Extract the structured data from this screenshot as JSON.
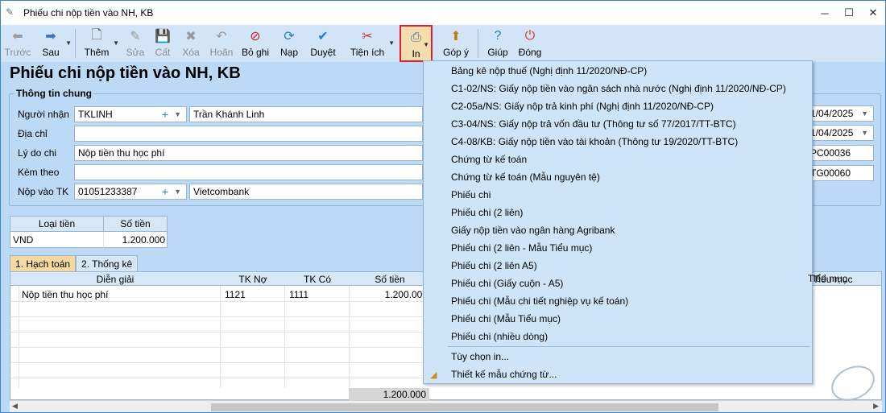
{
  "window": {
    "title": "Phiếu chi nộp tiền vào NH, KB"
  },
  "toolbar": {
    "back": "Trước",
    "forward": "Sau",
    "add": "Thêm",
    "edit": "Sửa",
    "save": "Cất",
    "delete": "Xóa",
    "undo": "Hoãn",
    "unpost": "Bỏ ghi",
    "reload": "Nạp",
    "approve": "Duyệt",
    "utilities": "Tiện ích",
    "print": "In",
    "feedback": "Góp ý",
    "help": "Giúp",
    "close": "Đóng"
  },
  "page": {
    "heading": "Phiếu chi nộp tiền vào NH, KB"
  },
  "general": {
    "legend": "Thông tin chung",
    "receiver_label": "Người nhận",
    "receiver_code": "TKLINH",
    "receiver_name": "Trần Khánh Linh",
    "address_label": "Địa chỉ",
    "address_value": "",
    "reason_label": "Lý do chi",
    "reason_value": "Nộp tiền thu học phí",
    "attach_label": "Kèm theo",
    "attach_value": "",
    "account_label": "Nộp vào TK",
    "account_no": "01051233387",
    "bank_name": "Vietcombank"
  },
  "right": {
    "date1": "1/04/2025",
    "date2": "1/04/2025",
    "no1": "PC00036",
    "no2": "TG00060"
  },
  "money": {
    "h_currency": "Loại tiền",
    "h_amount": "Số tiền",
    "currency": "VND",
    "amount": "1.200.000"
  },
  "tabs": [
    {
      "label": "1. Hạch toán"
    },
    {
      "label": "2. Thống kê"
    }
  ],
  "grid": {
    "h_desc": "Diễn giải",
    "h_debit": "TK Nợ",
    "h_credit": "TK Có",
    "h_amount": "Số tiền",
    "h_subitem": "Tiểu mục",
    "rows": [
      {
        "desc": "Nộp tiền thu học phí",
        "debit": "1121",
        "credit": "1111",
        "amount": "1.200.000"
      }
    ],
    "total": "1.200.000"
  },
  "print_menu": {
    "items": [
      "Bảng kê nộp thuế (Nghị định 11/2020/NĐ-CP)",
      "C1-02/NS: Giấy nộp tiền vào ngân sách nhà nước (Nghị định 11/2020/NĐ-CP)",
      "C2-05a/NS: Giấy nộp trả kinh phí (Nghị định 11/2020/NĐ-CP)",
      "C3-04/NS: Giấy nộp trả vốn đầu tư (Thông tư số 77/2017/TT-BTC)",
      "C4-08/KB: Giấy nộp tiền vào tài khoản (Thông tư 19/2020/TT-BTC)",
      "Chứng từ kế toán",
      "Chứng từ kế toán (Mẫu nguyên tệ)",
      "Phiếu chi",
      "Phiếu chi (2 liên)",
      "Giấy nộp tiền vào ngân hàng Agribank",
      "Phiếu chi (2 liên - Mẫu Tiểu mục)",
      "Phiếu chi (2 liên A5)",
      "Phiếu chi (Giấy cuộn - A5)",
      "Phiếu chi (Mẫu chi tiết nghiệp vụ kế toán)",
      "Phiếu chi (Mẫu Tiểu mục)",
      "Phiếu chi (nhiều dòng)"
    ],
    "options": "Tùy chọn in...",
    "design": "Thiết kế mẫu chứng từ..."
  }
}
